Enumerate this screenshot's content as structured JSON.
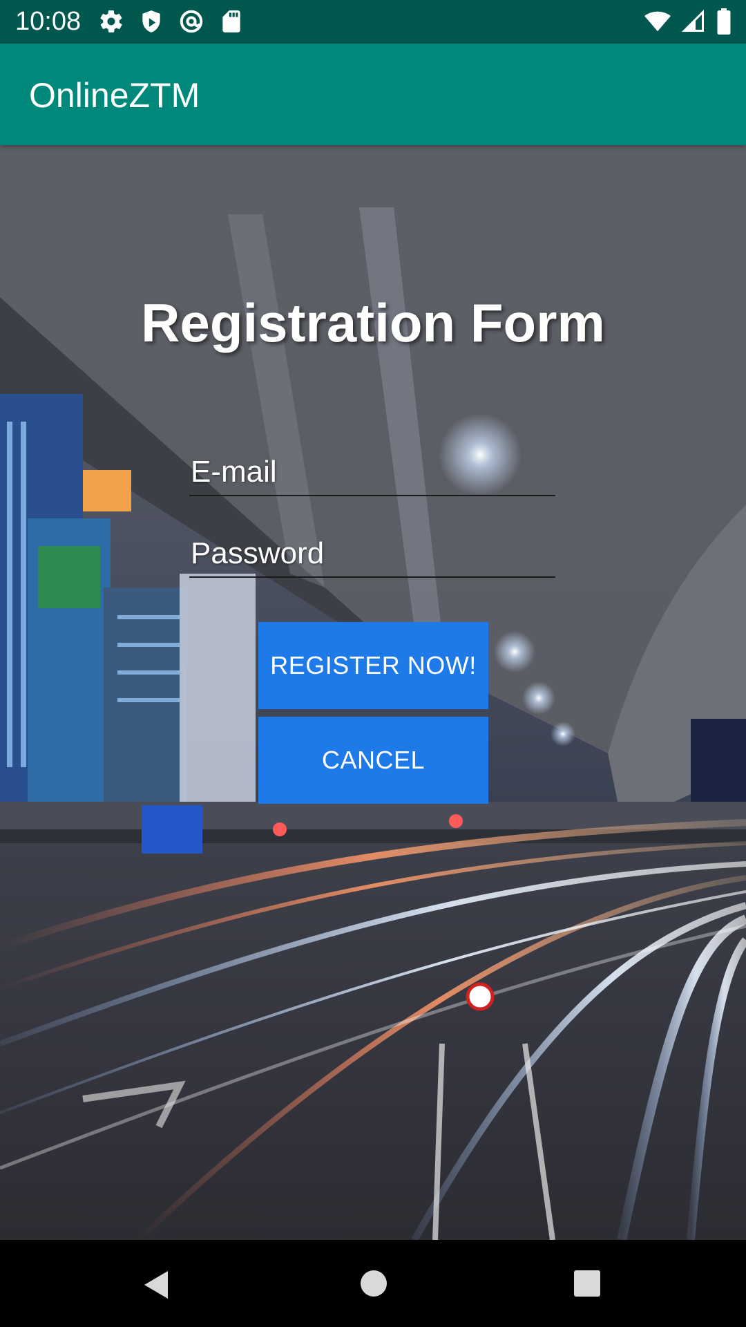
{
  "status_bar": {
    "time": "10:08",
    "left_icons": [
      "gear-icon",
      "shield-icon",
      "at-sign-icon",
      "sd-card-icon"
    ],
    "right_icons": [
      "wifi-icon",
      "signal-icon",
      "battery-icon"
    ]
  },
  "app_bar": {
    "title": "OnlineZTM",
    "color": "#00897b",
    "status_color": "#00574e"
  },
  "form": {
    "title": "Registration Form",
    "email_placeholder": "E-mail",
    "password_placeholder": "Password",
    "register_label": "REGISTER NOW!",
    "cancel_label": "CANCEL",
    "button_color": "#1e7ae9"
  },
  "nav_bar": {
    "icons": [
      "back-icon",
      "home-icon",
      "recents-icon"
    ]
  }
}
